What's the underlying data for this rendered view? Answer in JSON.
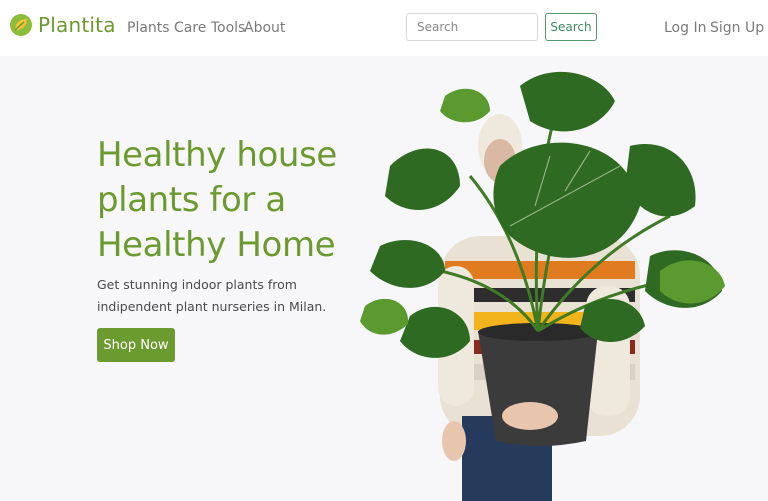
{
  "brand": {
    "name": "Plantita",
    "logo_icon": "leaf-logo-icon"
  },
  "nav": {
    "links": [
      {
        "label": "Plants"
      },
      {
        "label": "Care Tools"
      },
      {
        "label": "About"
      }
    ],
    "search": {
      "placeholder": "Search",
      "value": "",
      "button_label": "Search"
    },
    "auth": {
      "login_label": "Log In",
      "signup_label": "Sign Up"
    }
  },
  "hero": {
    "title": "Healthy house plants for a Healthy Home",
    "subtitle": "Get stunning indoor plants from indipendent plant nurseries in Milan.",
    "cta_label": "Shop Now",
    "image_icon": "person-holding-monstera-plant"
  },
  "colors": {
    "brand_green": "#6b9a2e",
    "search_button_border": "#4f9a6f",
    "nav_link": "#7b7b7b",
    "background": "#f7f7f9",
    "leaf_dark": "#2f6a22",
    "pot": "#3b3b3b"
  }
}
